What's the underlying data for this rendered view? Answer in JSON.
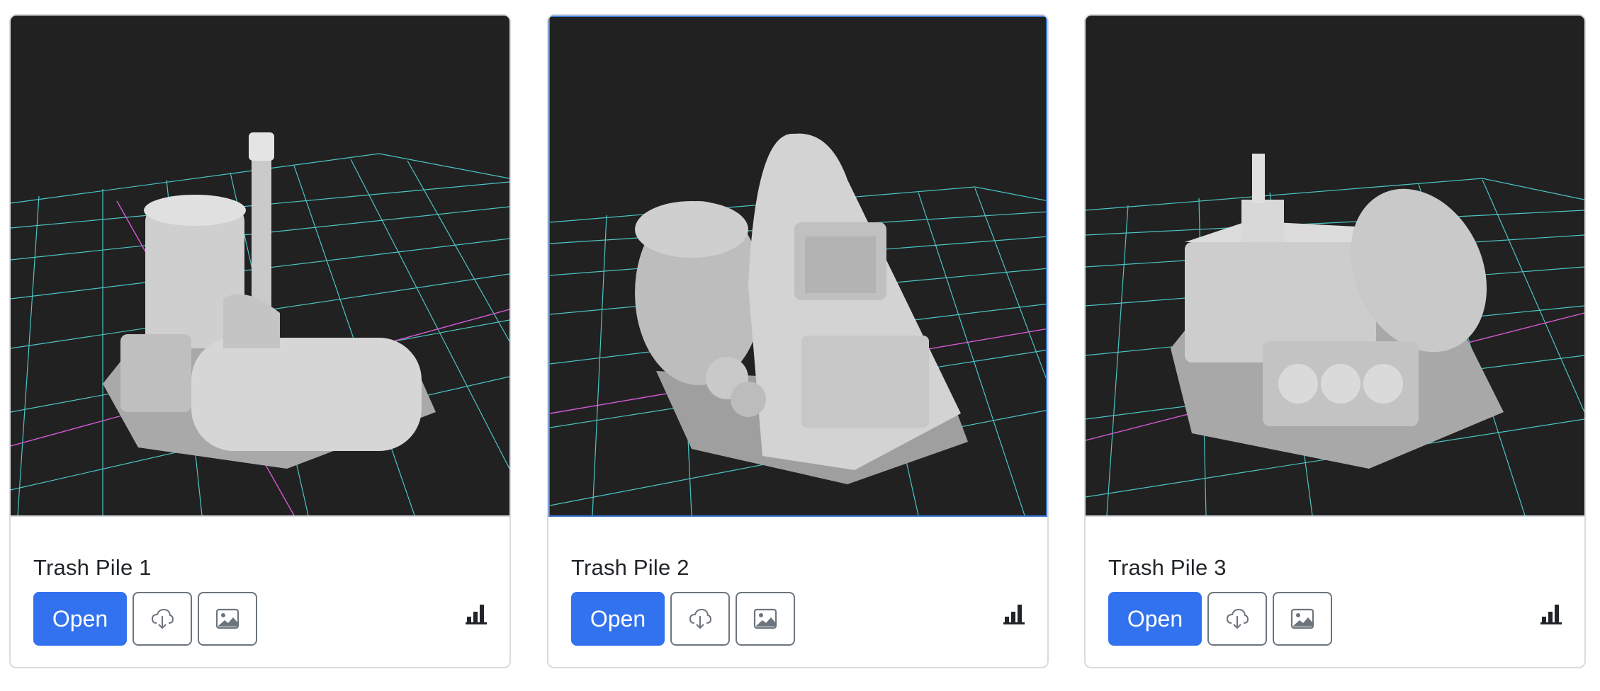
{
  "accent_color": "#3272ef",
  "cards": [
    {
      "title": "Trash Pile 1",
      "open_label": "Open",
      "selected": false,
      "icons": [
        "cloud-download-icon",
        "image-icon",
        "bar-chart-icon"
      ]
    },
    {
      "title": "Trash Pile 2",
      "open_label": "Open",
      "selected": true,
      "icons": [
        "cloud-download-icon",
        "image-icon",
        "bar-chart-icon"
      ]
    },
    {
      "title": "Trash Pile 3",
      "open_label": "Open",
      "selected": false,
      "icons": [
        "cloud-download-icon",
        "image-icon",
        "bar-chart-icon"
      ]
    }
  ]
}
